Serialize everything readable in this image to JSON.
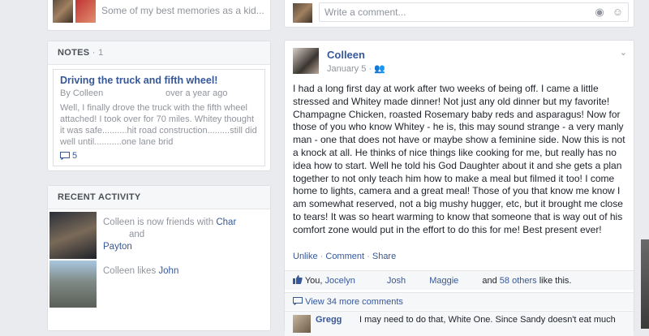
{
  "photos_strip": {
    "caption": "Some of my best memories as a kid..."
  },
  "notes": {
    "header": "NOTES",
    "count": "· 1",
    "item": {
      "title": "Driving the truck and fifth wheel!",
      "author": "By Colleen",
      "ago": "over a year ago",
      "body": "Well, I finally drove the truck with the fifth wheel attached! I took over for 70 miles. Whitey thought it was safe..........hit road construction.........still did well until...........one lane brid",
      "comments": "5",
      "comment_icon": "comment-icon"
    }
  },
  "recent_activity": {
    "header": "RECENT ACTIVITY",
    "items": [
      {
        "prefix": "Colleen is now friends with ",
        "link1": "Char",
        "mid": "and",
        "link2": "Payton"
      },
      {
        "prefix": "Colleen likes ",
        "link1": "John"
      }
    ]
  },
  "composer": {
    "placeholder": "Write a comment...",
    "camera_icon": "camera-icon",
    "emoji_icon": "emoji-icon"
  },
  "post": {
    "author": "Colleen",
    "date": "January 5 ·",
    "audience_icon": "friends-icon",
    "text": "I had a long first day at work after two weeks of being off. I came a little stressed and Whitey made dinner! Not just any old dinner but my favorite! Champagne Chicken, roasted Rosemary baby reds and asparagus! Now for those of you who know Whitey - he is, this may sound strange - a very manly man - one that does not have or maybe show a feminine side. Now this is not a knock at all. He thinks of nice things like cooking for me, but really has no idea how to start. Well he told his God Daughter about it and she gets a plan together to not only teach him how to make a meal but filmed it too! I come home to lights, camera and a great meal! Those of you that know me know I am somewhat reserved, not a big mushy hugger, etc, but it brought me close to tears! It was so heart warming to know that someone that is way out of his comfort zone would put in the effort to do this for me! Best present ever!",
    "actions": {
      "unlike": "Unlike",
      "comment": "Comment",
      "share": "Share",
      "sep": "·"
    },
    "likes": {
      "icon": "thumbs-up-icon",
      "you": "You,",
      "names": [
        "Jocelyn",
        "Josh",
        "Maggie"
      ],
      "and": "and",
      "others": "58 others",
      "suffix": "like this."
    },
    "view_more": {
      "icon": "comment-icon",
      "label": "View 34 more comments"
    },
    "comment": {
      "author": "Gregg",
      "text": "I may need to do that, White One. Since Sandy doesn't eat much"
    }
  }
}
